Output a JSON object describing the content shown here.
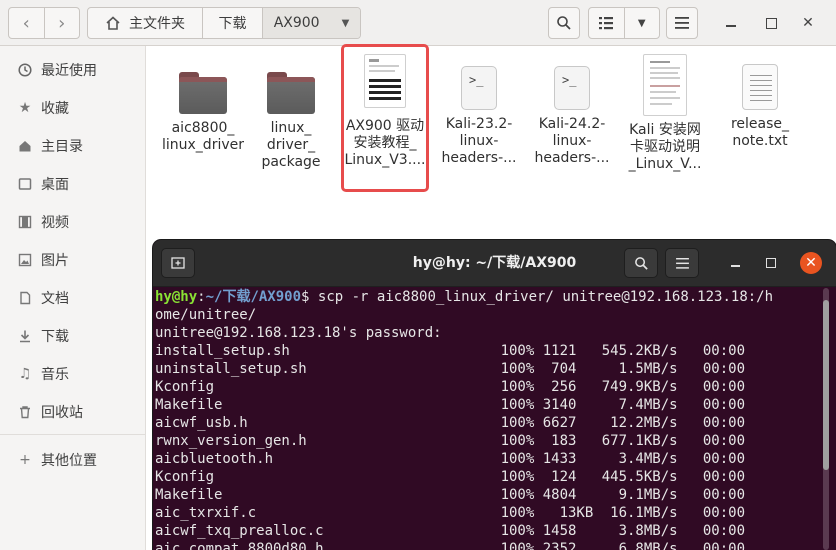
{
  "file_manager": {
    "breadcrumbs": {
      "home": "主文件夹",
      "downloads": "下载",
      "current": "AX900"
    },
    "toolbar_icons": [
      "chevron-left-icon",
      "chevron-right-icon",
      "home-icon",
      "chevron-down-icon",
      "search-icon",
      "list-view-icon",
      "chevron-down-icon",
      "menu-icon",
      "minimize-icon",
      "close-icon"
    ],
    "sidebar": [
      {
        "label": "最近使用",
        "icon": "clock-icon"
      },
      {
        "label": "收藏",
        "icon": "star-icon"
      },
      {
        "label": "主目录",
        "icon": "home-icon"
      },
      {
        "label": "桌面",
        "icon": "desktop-icon"
      },
      {
        "label": "视频",
        "icon": "video-icon"
      },
      {
        "label": "图片",
        "icon": "image-icon"
      },
      {
        "label": "文档",
        "icon": "document-icon"
      },
      {
        "label": "下载",
        "icon": "download-icon"
      },
      {
        "label": "音乐",
        "icon": "music-icon"
      },
      {
        "label": "回收站",
        "icon": "trash-icon"
      },
      {
        "label": "其他位置",
        "icon": "plus-icon"
      }
    ],
    "files": [
      {
        "name": "aic8800_ linux_driver",
        "l1": "aic8800_",
        "l2": "linux_driver",
        "l3": "",
        "type": "folder"
      },
      {
        "name": "linux_ driver_ package",
        "l1": "linux_",
        "l2": "driver_",
        "l3": "package",
        "type": "folder"
      },
      {
        "name": "AX900 驱动安装教程_Linux_V3....",
        "l1": "AX900 驱动",
        "l2": "安装教程_",
        "l3": "Linux_V3....",
        "type": "pdf",
        "selected": true
      },
      {
        "name": "Kali-23.2- linux- headers-...",
        "l1": "Kali-23.2-",
        "l2": "linux-",
        "l3": "headers-...",
        "type": "script"
      },
      {
        "name": "Kali-24.2- linux- headers-...",
        "l1": "Kali-24.2-",
        "l2": "linux-",
        "l3": "headers-...",
        "type": "script"
      },
      {
        "name": "Kali 安装网卡驱动说明_Linux_V...",
        "l1": "Kali 安装网",
        "l2": "卡驱动说明",
        "l3": "_Linux_V...",
        "type": "pdf"
      },
      {
        "name": "release_ note.txt",
        "l1": "release_",
        "l2": "note.txt",
        "l3": "",
        "type": "text"
      }
    ]
  },
  "terminal": {
    "title": "hy@hy: ~/下载/AX900",
    "prompt_user": "hy@hy",
    "prompt_sep": ":",
    "prompt_path": "~/下载/AX900",
    "prompt_dollar": "$ ",
    "command_1": "scp -r aic8800_linux_driver/ unitree@192.168.123.18:/h",
    "command_2": "ome/unitree/",
    "password_line": "unitree@192.168.123.18's password:",
    "transfers": [
      "install_setup.sh                         100% 1121   545.2KB/s   00:00",
      "uninstall_setup.sh                       100%  704     1.5MB/s   00:00",
      "Kconfig                                  100%  256   749.9KB/s   00:00",
      "Makefile                                 100% 3140     7.4MB/s   00:00",
      "aicwf_usb.h                              100% 6627    12.2MB/s   00:00",
      "rwnx_version_gen.h                       100%  183   677.1KB/s   00:00",
      "aicbluetooth.h                           100% 1433     3.4MB/s   00:00",
      "Kconfig                                  100%  124   445.5KB/s   00:00",
      "Makefile                                 100% 4804     9.1MB/s   00:00",
      "aic_txrxif.c                             100%   13KB  16.1MB/s   00:00",
      "aicwf_txq_prealloc.c                     100% 1458     3.8MB/s   00:00",
      "aic_compat_8800d80.h                     100% 2352     6.8MB/s   00:00"
    ]
  },
  "colors": {
    "terminal_bg": "#300a24",
    "prompt_user": "#8ae234",
    "prompt_path": "#729fcf",
    "close_button": "#e95420",
    "selection_outline": "#e74c4c"
  }
}
